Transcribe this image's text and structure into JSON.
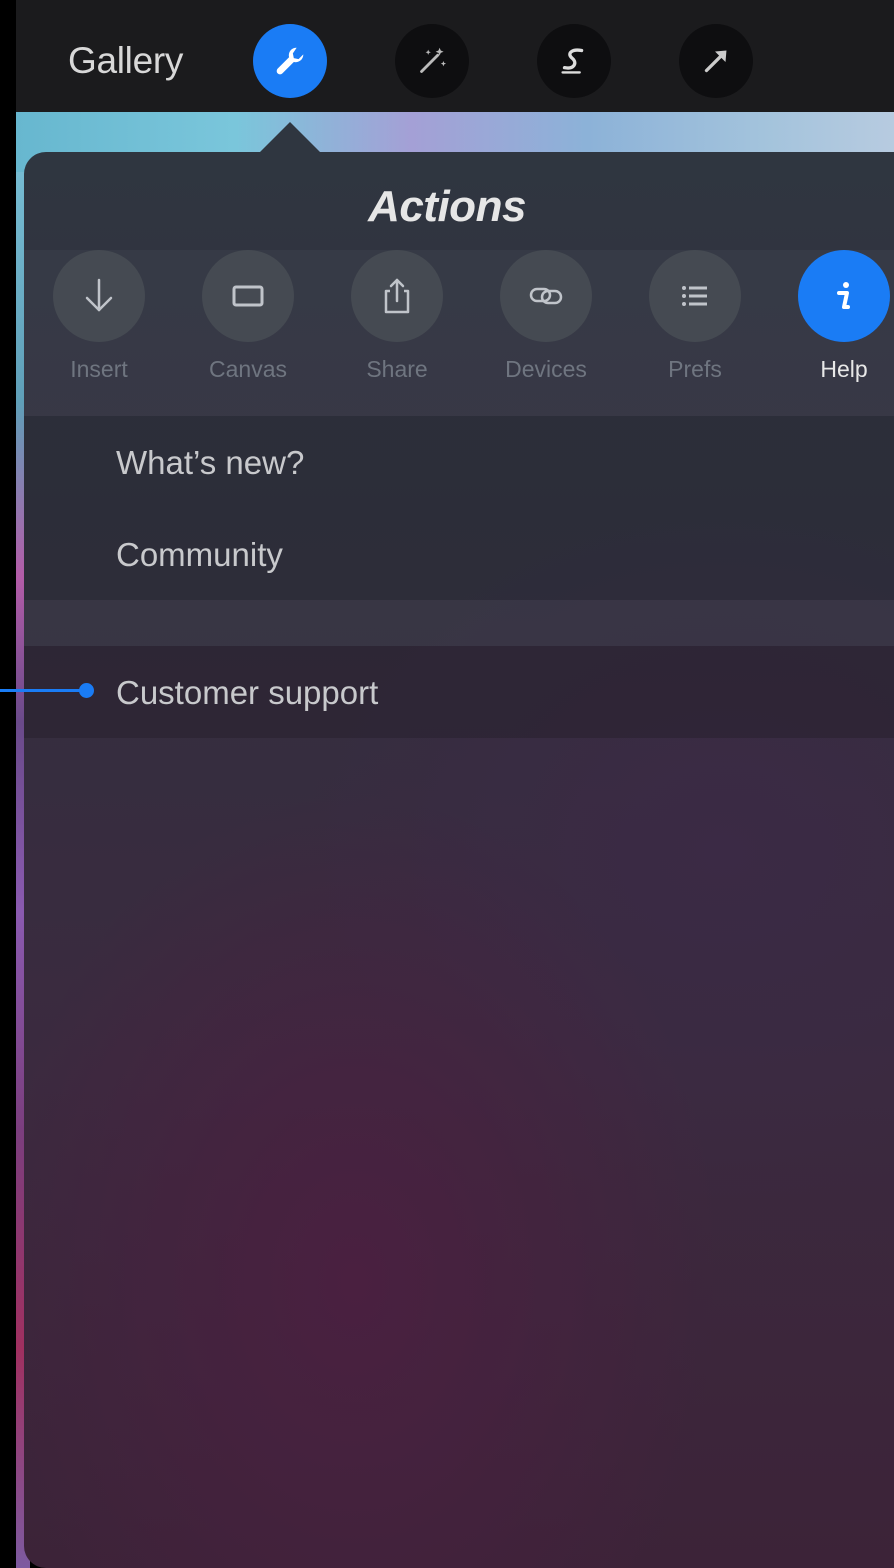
{
  "toolbar": {
    "gallery_label": "Gallery",
    "tools": [
      {
        "name": "actions",
        "icon": "wrench-icon",
        "active": true
      },
      {
        "name": "adjustments",
        "icon": "magic-wand-icon",
        "active": false
      },
      {
        "name": "selection",
        "icon": "selection-icon",
        "active": false
      },
      {
        "name": "transform",
        "icon": "arrow-icon",
        "active": false
      }
    ]
  },
  "popover": {
    "title": "Actions",
    "tabs": [
      {
        "label": "Insert",
        "icon": "download-arrow-icon",
        "active": false
      },
      {
        "label": "Canvas",
        "icon": "rectangle-icon",
        "active": false
      },
      {
        "label": "Share",
        "icon": "share-icon",
        "active": false
      },
      {
        "label": "Devices",
        "icon": "link-icon",
        "active": false
      },
      {
        "label": "Prefs",
        "icon": "list-icon",
        "active": false
      },
      {
        "label": "Help",
        "icon": "info-icon",
        "active": true
      }
    ],
    "menu_items": [
      {
        "label": "What’s new?"
      },
      {
        "label": "Community"
      },
      {
        "label": "Customer support"
      }
    ]
  },
  "colors": {
    "accent": "#1a7cf5",
    "toolbar_bg": "#1b1b1d",
    "inactive_tab_label": "#6f7580"
  }
}
